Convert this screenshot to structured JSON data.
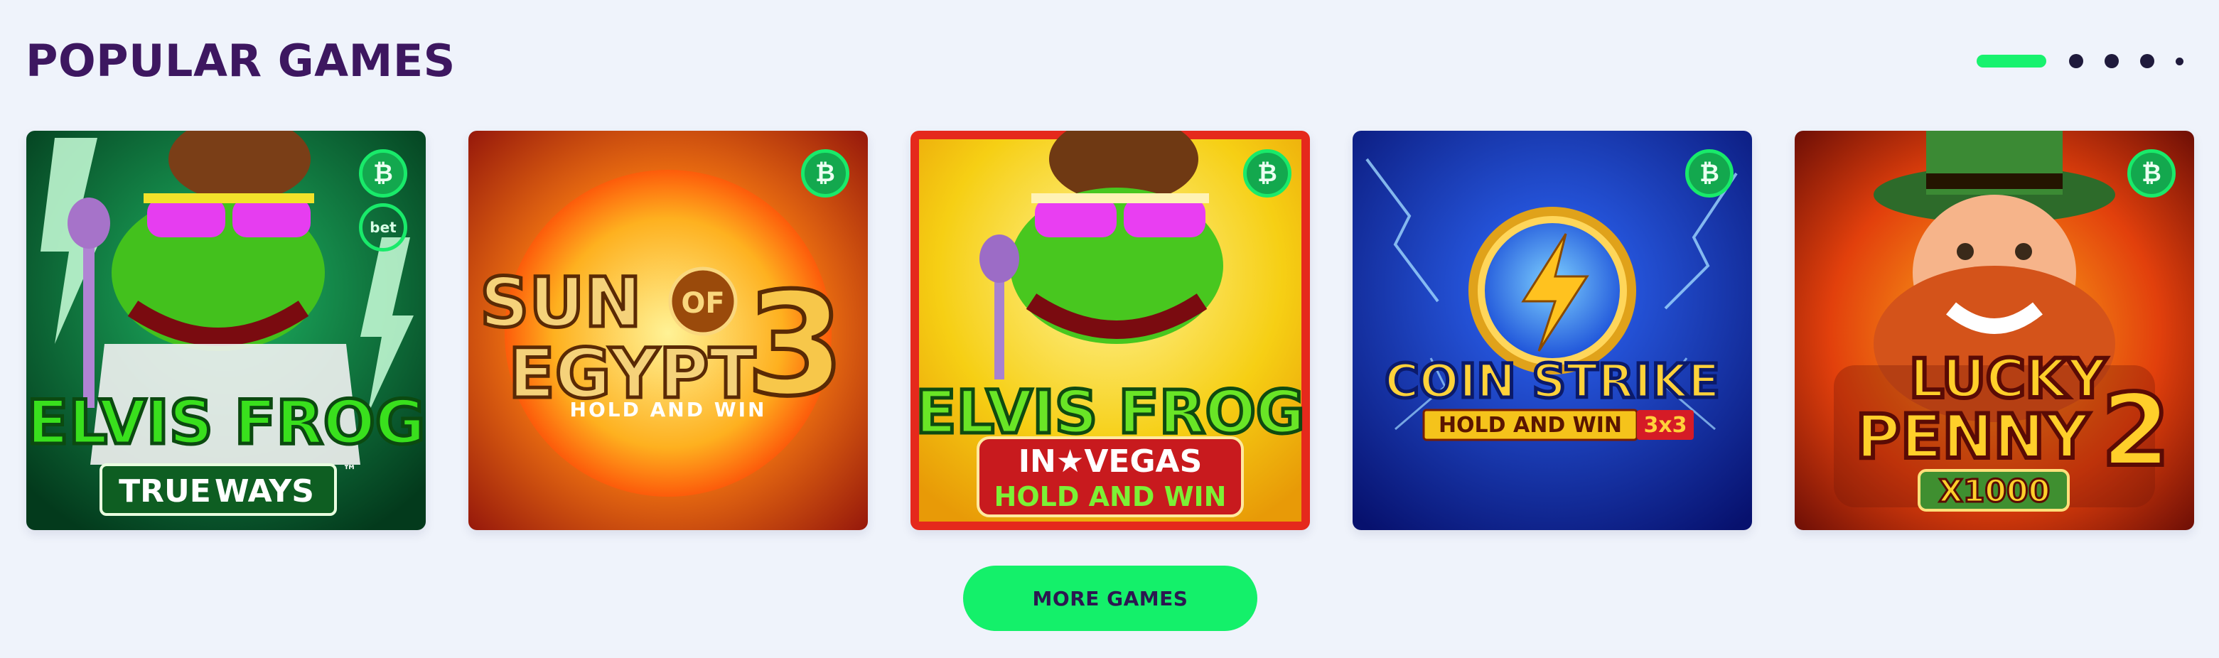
{
  "section": {
    "title": "POPULAR GAMES"
  },
  "pager": {
    "active_index": 0,
    "page_count": 5
  },
  "games": [
    {
      "name": "Elvis Frog True Ways",
      "art_line1": "ELVIS FROG",
      "art_line2": "TRUE",
      "art_line3": "WAYS",
      "tm": "™",
      "badges": [
        "bitcoin-icon",
        "bet-icon"
      ]
    },
    {
      "name": "Sun of Egypt 3",
      "art_line1": "SUN",
      "art_of": "OF",
      "art_line2": "EGYPT",
      "art_num": "3",
      "art_sub": "HOLD AND WIN",
      "badges": [
        "bitcoin-icon"
      ]
    },
    {
      "name": "Elvis Frog in Vegas",
      "art_line1": "ELVIS FROG",
      "art_line2": "IN★VEGAS",
      "art_sub": "HOLD AND WIN",
      "badges": [
        "bitcoin-icon"
      ]
    },
    {
      "name": "Coin Strike Hold and Win",
      "art_line1": "COIN STRIKE",
      "art_sub": "HOLD AND WIN",
      "art_tag": "3x3",
      "badges": [
        "bitcoin-icon"
      ]
    },
    {
      "name": "Lucky Penny 2",
      "art_line1": "LUCKY",
      "art_line2": "PENNY",
      "art_num": "2",
      "art_sub": "X1000",
      "badges": [
        "bitcoin-icon"
      ]
    }
  ],
  "coin_symbol": "₿",
  "bet_symbol": "bet",
  "more_button": {
    "label": "MORE GAMES"
  },
  "colors": {
    "accent": "#14f06a",
    "title": "#3d1760",
    "background": "#eff3fb"
  }
}
